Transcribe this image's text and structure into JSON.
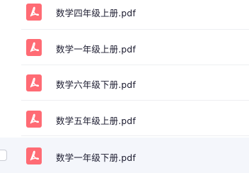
{
  "files": [
    {
      "name": "数学四年级上册.pdf",
      "icon": "pdf-icon"
    },
    {
      "name": "数学一年级上册.pdf",
      "icon": "pdf-icon"
    },
    {
      "name": "数学六年级下册.pdf",
      "icon": "pdf-icon"
    },
    {
      "name": "数学五年级上册.pdf",
      "icon": "pdf-icon"
    },
    {
      "name": "数学一年级下册.pdf",
      "icon": "pdf-icon"
    }
  ],
  "colors": {
    "pdf_icon": "#ff6b74",
    "hover_row": "#f4f6fb",
    "divider": "#eeeff2",
    "text": "#1a1a2e"
  }
}
